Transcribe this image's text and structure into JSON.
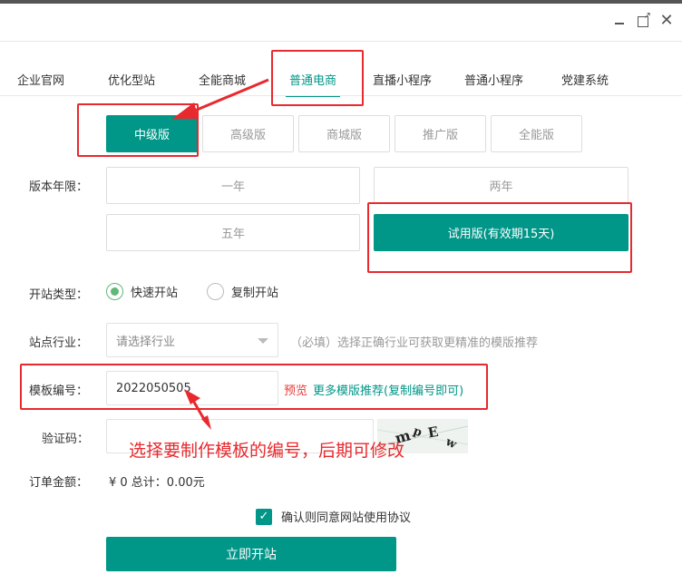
{
  "window": {
    "controls": {
      "minimize": "minimize-icon",
      "maximize": "maximize-icon",
      "close": "close-icon"
    }
  },
  "tabs": [
    {
      "label": "企业官网"
    },
    {
      "label": "优化型站"
    },
    {
      "label": "全能商城"
    },
    {
      "label": "普通电商",
      "active": true
    },
    {
      "label": "直播小程序"
    },
    {
      "label": "普通小程序"
    },
    {
      "label": "党建系统"
    }
  ],
  "editions": [
    {
      "label": "中级版",
      "selected": true
    },
    {
      "label": "高级版"
    },
    {
      "label": "商城版"
    },
    {
      "label": "推广版"
    },
    {
      "label": "全能版"
    }
  ],
  "period": {
    "label": "版本年限：",
    "options": [
      {
        "label": "一年"
      },
      {
        "label": "两年"
      },
      {
        "label": "五年"
      },
      {
        "label": "试用版(有效期15天)",
        "selected": true
      }
    ]
  },
  "site_type": {
    "label": "开站类型：",
    "options": [
      {
        "label": "快速开站",
        "checked": true
      },
      {
        "label": "复制开站",
        "checked": false
      }
    ]
  },
  "industry": {
    "label": "站点行业：",
    "placeholder": "请选择行业",
    "hint": "（必填）选择正确行业可获取更精准的模版推荐"
  },
  "template": {
    "label": "模板编号：",
    "value": "2022050505",
    "preview_link": "预览",
    "more_link": "更多模版推荐(复制编号即可)"
  },
  "captcha": {
    "label": "验证码：",
    "value": "",
    "image_text": "ṁ ᵖ E ᴡ"
  },
  "order": {
    "label": "订单金额：",
    "text": "¥ 0 总计：0.00元"
  },
  "agreement": {
    "checked": true,
    "label": "确认则同意网站使用协议"
  },
  "submit": {
    "label": "立即开站"
  },
  "annotation": {
    "text": "选择要制作模板的编号，后期可修改",
    "color": "#e8292e"
  },
  "colors": {
    "accent": "#009688",
    "radio": "#5fb878",
    "link_red": "#e53935"
  }
}
